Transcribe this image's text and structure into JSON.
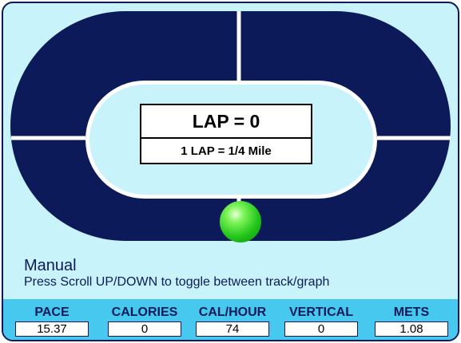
{
  "lap_display": {
    "title": "LAP = 0",
    "subtitle": "1 LAP = 1/4 Mile"
  },
  "mode": {
    "label": "Manual",
    "hint": "Press Scroll UP/DOWN to toggle between track/graph"
  },
  "stats": [
    {
      "label": "PACE",
      "value": "15.37"
    },
    {
      "label": "CALORIES",
      "value": "0"
    },
    {
      "label": "CAL/HOUR",
      "value": "74"
    },
    {
      "label": "VERTICAL",
      "value": "0"
    },
    {
      "label": "METS",
      "value": "1.08"
    }
  ],
  "colors": {
    "screen_background": "#c9f3fb",
    "track": "#0c1a5a",
    "track_lines": "#ffffff",
    "stats_bar": "#47c8ee",
    "runner_ball": "#22c41a"
  },
  "icons": {
    "runner_position": "green-ball-icon"
  }
}
